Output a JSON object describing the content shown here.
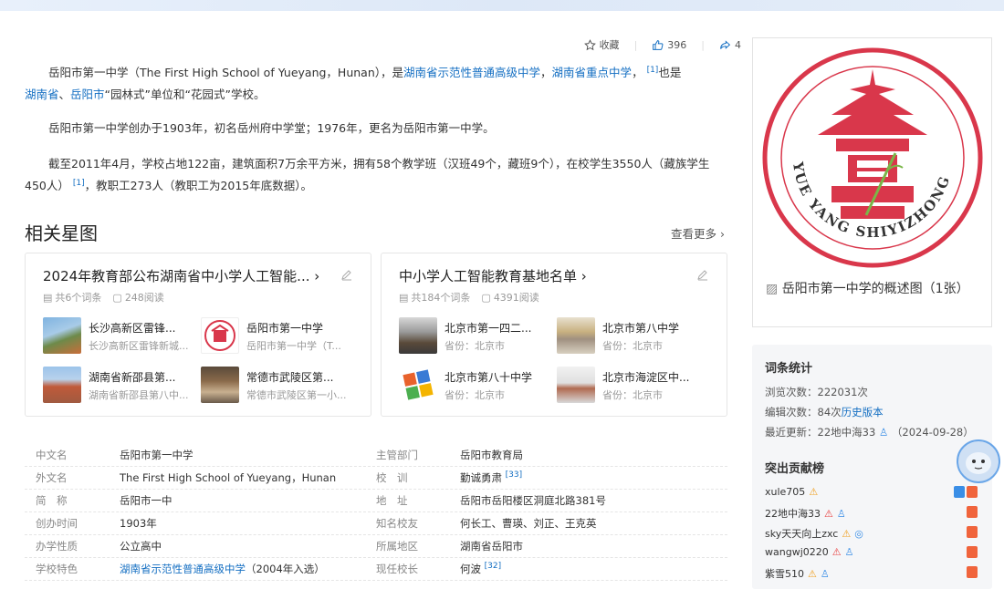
{
  "actions": {
    "collect": "收藏",
    "like_count": "396",
    "share_count": "4"
  },
  "intro": {
    "p1": {
      "a": "岳阳市第一中学（The First High School of Yueyang，Hunan），是",
      "link1": "湖南省示范性普通高级中学",
      "sep": "，",
      "link2": "湖南省重点中学",
      "b": "，",
      "ref": "[1]",
      "c": "也是",
      "link3": "湖南省",
      "d": "、",
      "link4": "岳阳市",
      "e": "“园林式”单位和“花园式”学校。"
    },
    "p2": "岳阳市第一中学创办于1903年，初名岳州府中学堂；1976年，更名为岳阳市第一中学。",
    "p3a": "截至2011年4月，学校占地122亩，建筑面积7万余平方米，拥有58个教学班（汉班49个，藏班9个），在校学生3550人（藏族学生450人）",
    "p3ref": "[1]",
    "p3b": "，教职工273人（教职工为2015年底数据）。"
  },
  "related": {
    "title": "相关星图",
    "see_more": "查看更多",
    "cards": [
      {
        "title": "2024年教育部公布湖南省中小学人工智能...",
        "entries_count": "共6个词条",
        "reads": "248阅读",
        "items": [
          {
            "name": "长沙高新区雷锋...",
            "sub": "长沙高新区雷锋新城..."
          },
          {
            "name": "岳阳市第一中学",
            "sub": "岳阳市第一中学（T..."
          },
          {
            "name": "湖南省新邵县第...",
            "sub": "湖南省新邵县第八中..."
          },
          {
            "name": "常德市武陵区第...",
            "sub": "常德市武陵区第一小..."
          }
        ]
      },
      {
        "title": "中小学人工智能教育基地名单",
        "entries_count": "共184个词条",
        "reads": "4391阅读",
        "items": [
          {
            "name": "北京市第一四二...",
            "sub": "省份：北京市"
          },
          {
            "name": "北京市第八中学",
            "sub": "省份：北京市"
          },
          {
            "name": "北京市第八十中学",
            "sub": "省份：北京市"
          },
          {
            "name": "北京市海淀区中...",
            "sub": "省份：北京市"
          }
        ]
      }
    ]
  },
  "infobox": [
    {
      "k": "中文名",
      "v": "岳阳市第一中学",
      "k2": "主管部门",
      "v2": "岳阳市教育局",
      "v2_link": true
    },
    {
      "k": "外文名",
      "v": "The First High School of Yueyang，Hunan",
      "k2": "校　训",
      "v2": "勤诚勇肃",
      "v2_ref": "[33]"
    },
    {
      "k": "简　称",
      "v": "岳阳市一中",
      "k2": "地　址",
      "v2": "岳阳市岳阳楼区洞庭北路381号"
    },
    {
      "k": "创办时间",
      "v": "1903年",
      "k2": "知名校友",
      "v2": "何长工、曹瑛、刘正、王克英",
      "v2_link": true
    },
    {
      "k": "办学性质",
      "v": "公立高中",
      "k2": "所属地区",
      "v2": "湖南省岳阳市"
    },
    {
      "k": "学校特色",
      "v": "湖南省示范性普通高级中学",
      "v_extra": "（2004年入选）",
      "v_link": true,
      "k2": "现任校长",
      "v2": "何波",
      "v2_ref": "[32]"
    }
  ],
  "album": {
    "caption": "岳阳市第一中学的概述图（1张）",
    "logo_text": "YUE YANG SHIYIZHONG"
  },
  "stats": {
    "title": "词条统计",
    "views": "浏览次数：222031次",
    "edits": "编辑次数：84次",
    "history": "历史版本",
    "updated": "最近更新：22地中海33",
    "updated_date": "（2024-09-28）",
    "contrib_title": "突出贡献榜",
    "contributors": [
      "xule705",
      "22地中海33",
      "sky天天向上zxc",
      "wangwj0220",
      "紫雪510"
    ]
  },
  "colors": {
    "link": "#136ec2",
    "logo_red": "#d9374b",
    "accent_green": "#7ab648"
  }
}
